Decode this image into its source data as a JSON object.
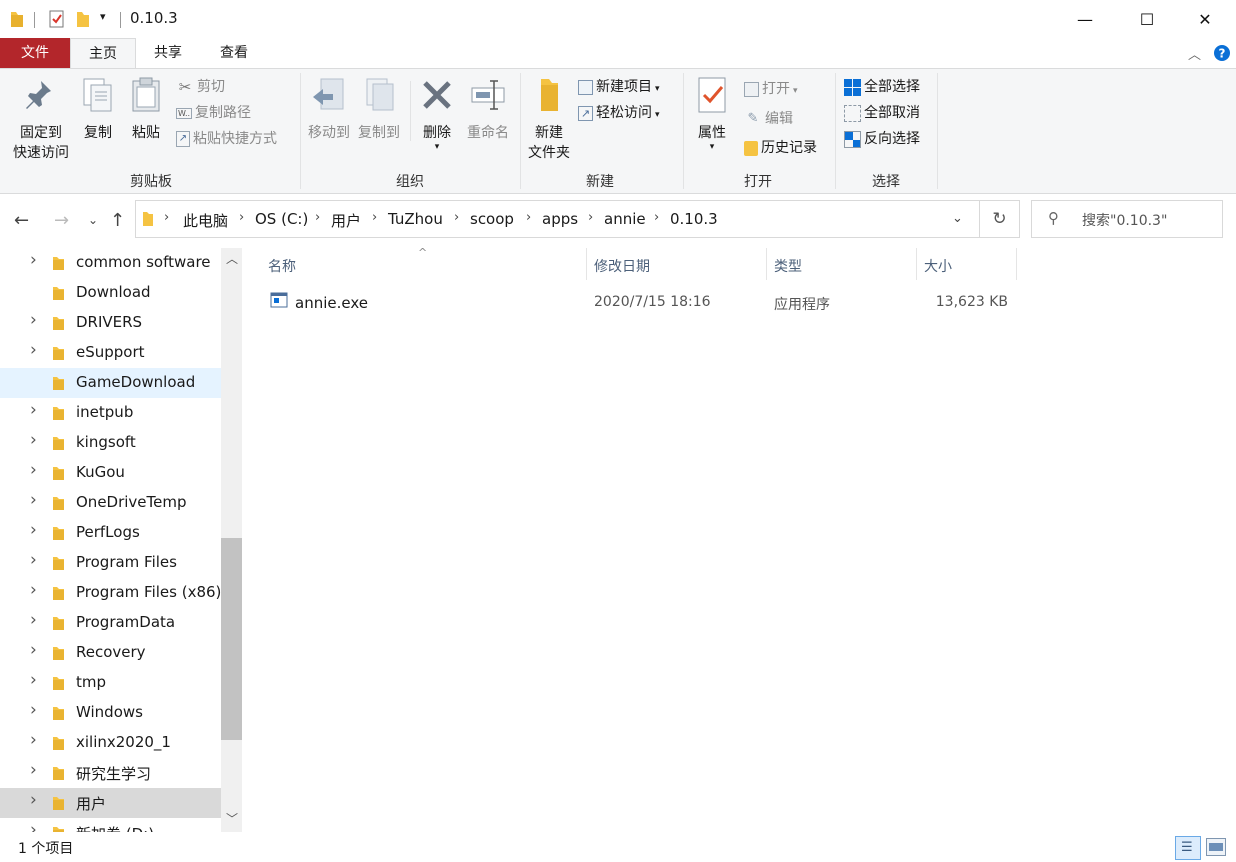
{
  "window": {
    "title": "0.10.3",
    "controls": {
      "minimize": "—",
      "maximize": "☐",
      "close": "✕"
    }
  },
  "ribbon_tabs": [
    {
      "label": "文件"
    },
    {
      "label": "主页"
    },
    {
      "label": "共享"
    },
    {
      "label": "查看"
    }
  ],
  "ribbon": {
    "clipboard": {
      "pin": "固定到\n快速访问",
      "pin_line1": "固定到",
      "pin_line2": "快速访问",
      "copy": "复制",
      "paste": "粘贴",
      "cut": "剪切",
      "copy_path": "复制路径",
      "paste_shortcut": "粘贴快捷方式",
      "group": "剪贴板"
    },
    "organize": {
      "move_to": "移动到",
      "copy_to": "复制到",
      "delete": "删除",
      "rename": "重命名",
      "group": "组织"
    },
    "new": {
      "new_folder_line1": "新建",
      "new_folder_line2": "文件夹",
      "new_item": "新建项目",
      "easy_access": "轻松访问",
      "group": "新建"
    },
    "open": {
      "properties": "属性",
      "open": "打开",
      "edit": "编辑",
      "history": "历史记录",
      "group": "打开"
    },
    "select": {
      "select_all": "全部选择",
      "select_none": "全部取消",
      "invert": "反向选择",
      "group": "选择"
    }
  },
  "address": {
    "crumbs": [
      "此电脑",
      "OS (C:)",
      "用户",
      "TuZhou",
      "scoop",
      "apps",
      "annie",
      "0.10.3"
    ],
    "search_placeholder": "搜索\"0.10.3\""
  },
  "nav_tree": [
    {
      "label": "common software",
      "expandable": true
    },
    {
      "label": "Download",
      "expandable": false
    },
    {
      "label": "DRIVERS",
      "expandable": true
    },
    {
      "label": "eSupport",
      "expandable": true
    },
    {
      "label": "GameDownload",
      "expandable": false,
      "hover": true
    },
    {
      "label": "inetpub",
      "expandable": true
    },
    {
      "label": "kingsoft",
      "expandable": true
    },
    {
      "label": "KuGou",
      "expandable": true
    },
    {
      "label": "OneDriveTemp",
      "expandable": true
    },
    {
      "label": "PerfLogs",
      "expandable": true
    },
    {
      "label": "Program Files",
      "expandable": true
    },
    {
      "label": "Program Files (x86)",
      "expandable": true
    },
    {
      "label": "ProgramData",
      "expandable": true
    },
    {
      "label": "Recovery",
      "expandable": true
    },
    {
      "label": "tmp",
      "expandable": true
    },
    {
      "label": "Windows",
      "expandable": true
    },
    {
      "label": "xilinx2020_1",
      "expandable": true
    },
    {
      "label": "研究生学习",
      "expandable": true
    },
    {
      "label": "用户",
      "expandable": true,
      "current": true
    },
    {
      "label": "新加卷 (D:)",
      "expandable": true
    }
  ],
  "file_columns": {
    "name": "名称",
    "modified": "修改日期",
    "type": "类型",
    "size": "大小"
  },
  "files": [
    {
      "name": "annie.exe",
      "modified": "2020/7/15 18:16",
      "type": "应用程序",
      "size": "13,623 KB"
    }
  ],
  "status": {
    "item_count": "1 个项目"
  },
  "colors": {
    "file_tab": "#b3262b",
    "folder": "#f5c342",
    "accent": "#0063b1"
  }
}
